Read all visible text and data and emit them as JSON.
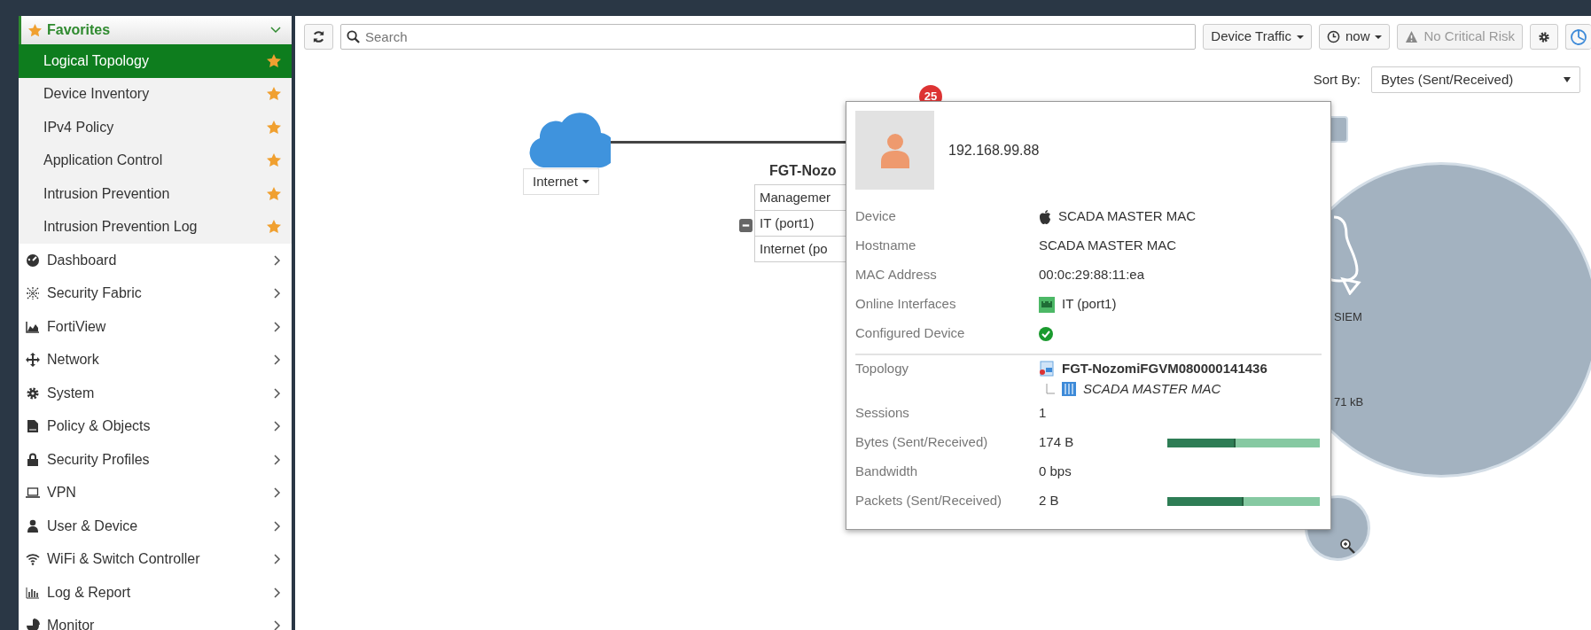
{
  "sidebar": {
    "favorites": {
      "label": "Favorites",
      "expanded": true,
      "items": [
        {
          "label": "Logical Topology",
          "selected": true
        },
        {
          "label": "Device Inventory",
          "selected": false
        },
        {
          "label": "IPv4 Policy",
          "selected": false
        },
        {
          "label": "Application Control",
          "selected": false
        },
        {
          "label": "Intrusion Prevention",
          "selected": false
        },
        {
          "label": "Intrusion Prevention Log",
          "selected": false
        }
      ]
    },
    "items": [
      {
        "label": "Dashboard"
      },
      {
        "label": "Security Fabric"
      },
      {
        "label": "FortiView"
      },
      {
        "label": "Network"
      },
      {
        "label": "System"
      },
      {
        "label": "Policy & Objects"
      },
      {
        "label": "Security Profiles"
      },
      {
        "label": "VPN"
      },
      {
        "label": "User & Device"
      },
      {
        "label": "WiFi & Switch Controller"
      },
      {
        "label": "Log & Report"
      },
      {
        "label": "Monitor"
      }
    ]
  },
  "toolbar": {
    "search": {
      "placeholder": "Search"
    },
    "traffic_menu": "Device Traffic",
    "time_menu": "now",
    "risk_button": {
      "label": "No Critical Risk",
      "disabled": true
    }
  },
  "sort": {
    "label": "Sort By:",
    "value": "Bytes (Sent/Received)"
  },
  "topology": {
    "internet": {
      "label": "Internet"
    },
    "firewall": {
      "name": "FGT-Nozo",
      "badge": "25",
      "ports": [
        "Managemer",
        "IT (port1)",
        "Internet (po"
      ]
    },
    "siem": {
      "name": "SIEM",
      "traffic": "71 kB"
    }
  },
  "tooltip": {
    "title": "192.168.99.88",
    "rows": [
      {
        "kind": "device",
        "label": "Device",
        "value": "SCADA MASTER MAC"
      },
      {
        "kind": "text",
        "label": "Hostname",
        "value": "SCADA MASTER MAC"
      },
      {
        "kind": "text",
        "label": "MAC Address",
        "value": "00:0c:29:88:11:ea"
      },
      {
        "kind": "interface",
        "label": "Online Interfaces",
        "value": "IT (port1)"
      },
      {
        "kind": "check",
        "label": "Configured Device",
        "checked": true
      },
      {
        "kind": "topology",
        "label": "Topology",
        "value": "FGT-NozomiFGVM080000141436",
        "child": "SCADA MASTER MAC"
      },
      {
        "kind": "text",
        "label": "Sessions",
        "value": "1"
      },
      {
        "kind": "bar",
        "label": "Bytes (Sent/Received)",
        "value": "174 B",
        "level": 0.45
      },
      {
        "kind": "text",
        "label": "Bandwidth",
        "value": "0 bps"
      },
      {
        "kind": "bar",
        "label": "Packets (Sent/Received)",
        "value": "2 B",
        "level": 0.5
      }
    ]
  }
}
